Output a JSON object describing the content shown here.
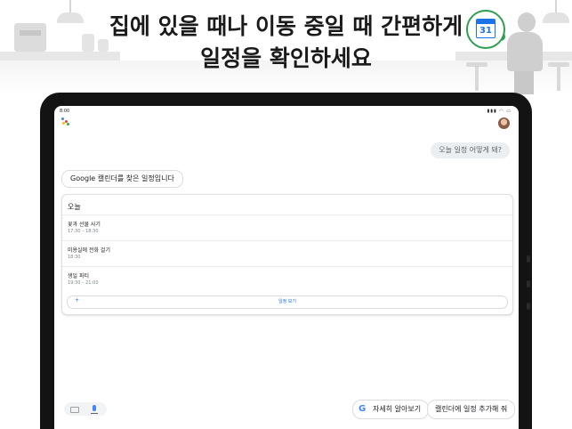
{
  "headline": {
    "line1": "집에 있을 때나 이동 중일 때 간편하게",
    "line2": "일정을 확인하세요"
  },
  "calendar_badge": {
    "day": "31"
  },
  "status_bar": {
    "time": "8:00",
    "icons": "▮▮▮ ◠ ▭"
  },
  "conversation": {
    "user_query": "오늘 일정 어떻게 돼?",
    "assistant_reply": "Google 캘린더를 찾은 일정입니다"
  },
  "schedule_card": {
    "title": "오늘",
    "events": [
      {
        "title": "꽃과 선물 사기",
        "time": "17:30 – 18:30"
      },
      {
        "title": "미용실에 전화 걸기",
        "time": "18:30"
      },
      {
        "title": "생일 파티",
        "time": "19:30 – 21:00"
      }
    ],
    "view_button": "일정 보기",
    "view_icon": "+"
  },
  "suggestions": {
    "learn_more": "자세히 알아보기",
    "add_event": "캘린더에 일정 추가해 줘",
    "google_logo": "G"
  },
  "colors": {
    "accent_blue": "#1a73e8",
    "badge_green": "#2e9e4f",
    "google_blue": "#4285f4",
    "google_red": "#ea4335",
    "google_yellow": "#fbbc05",
    "google_green": "#34a853"
  },
  "icons": {
    "assistant": "google-assistant-icon",
    "keyboard": "keyboard-icon",
    "mic": "microphone-icon",
    "calendar": "google-calendar-icon"
  }
}
